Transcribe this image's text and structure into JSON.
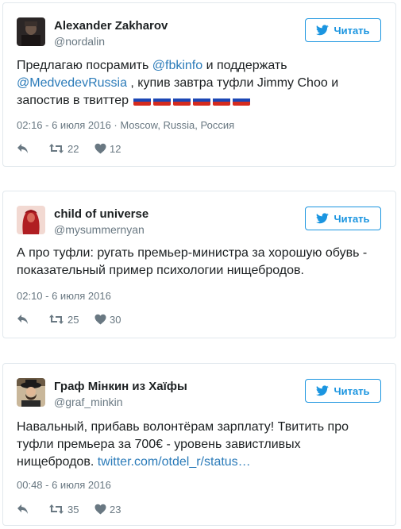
{
  "colors": {
    "accent": "#1b95e0",
    "link": "#2b7bb9",
    "muted": "#697882",
    "border": "#e1e8ed"
  },
  "tweets": [
    {
      "name": "Alexander Zakharov",
      "handle": "@nordalin",
      "follow_label": "Читать",
      "text_parts": {
        "p1": "Предлагаю посрамить ",
        "link1": "@fbkinfo",
        "p2": " и поддержать ",
        "link2": "@MedvedevRussia",
        "p3": " , купив завтра туфли Jimmy Choo и запостив в твиттер"
      },
      "flag_emoji_count": 6,
      "timestamp": "02:16 - 6 июля 2016",
      "location": " · Moscow, Russia, Россия",
      "retweets": "22",
      "likes": "12",
      "avatar_icon": "user-photo-avatar"
    },
    {
      "name": "child of universe",
      "handle": "@mysummernyan",
      "follow_label": "Читать",
      "text": "А про туфли: ругать премьер-министра за хорошую обувь - показательный пример психологии нищебродов.",
      "timestamp": "02:10 - 6 июля 2016",
      "retweets": "25",
      "likes": "30",
      "avatar_icon": "user-photo-avatar"
    },
    {
      "name": "Граф Mінкин из Хаїфы",
      "handle": "@graf_minkin",
      "follow_label": "Читать",
      "text_parts": {
        "p1": "Навальный, прибавь волонтёрам зарплату! Твитить про туфли премьера за 700€ - уровень завистливых нищебродов. ",
        "link1": "twitter.com/otdel_r/status…"
      },
      "timestamp": "00:48 - 6 июля 2016",
      "retweets": "35",
      "likes": "23",
      "avatar_icon": "user-photo-avatar"
    }
  ],
  "icons": {
    "follow": "twitter-bird-icon",
    "reply": "reply-icon",
    "retweet": "retweet-icon",
    "like": "heart-icon",
    "flag": "russian-flag-emoji"
  }
}
